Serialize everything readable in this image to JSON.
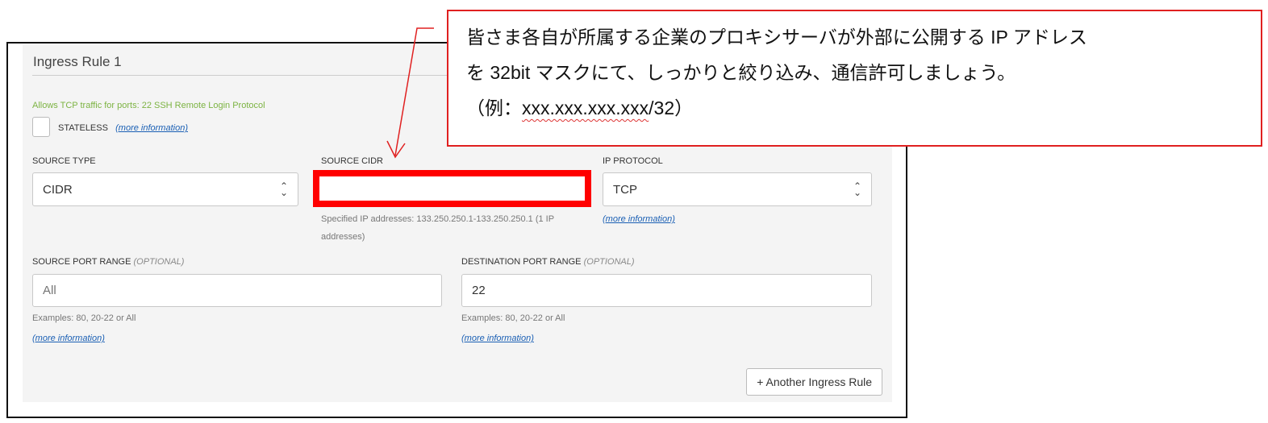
{
  "rule": {
    "title": "Ingress Rule 1",
    "description": "Allows TCP traffic for ports: 22 SSH Remote Login Protocol",
    "stateless_label": "STATELESS",
    "more_info": "(more information)",
    "source_type": {
      "label": "SOURCE TYPE",
      "value": "CIDR"
    },
    "source_cidr": {
      "label": "SOURCE CIDR",
      "value": "",
      "hint": "Specified IP addresses: 133.250.250.1-133.250.250.1 (1 IP addresses)"
    },
    "ip_protocol": {
      "label": "IP PROTOCOL",
      "value": "TCP"
    },
    "source_port": {
      "label": "SOURCE PORT RANGE",
      "optional": "(OPTIONAL)",
      "placeholder": "All",
      "examples": "Examples: 80, 20-22 or All"
    },
    "dest_port": {
      "label": "DESTINATION PORT RANGE",
      "optional": "(OPTIONAL)",
      "value": "22",
      "examples": "Examples: 80, 20-22 or All"
    },
    "add_button": "+ Another Ingress Rule"
  },
  "callout": {
    "line1": "皆さま各自が所属する企業のプロキシサーバが外部に公開する IP アドレス",
    "line2": "を 32bit マスクにて、しっかりと絞り込み、通信許可しましょう。",
    "line3_prefix": "（例：",
    "line3_example": "xxx.xxx.xxx.xxx",
    "line3_suffix": "/32）"
  },
  "colors": {
    "highlight": "#ff0000",
    "annotation": "#e02020",
    "success": "#7cb342",
    "link": "#1a5fb4"
  }
}
